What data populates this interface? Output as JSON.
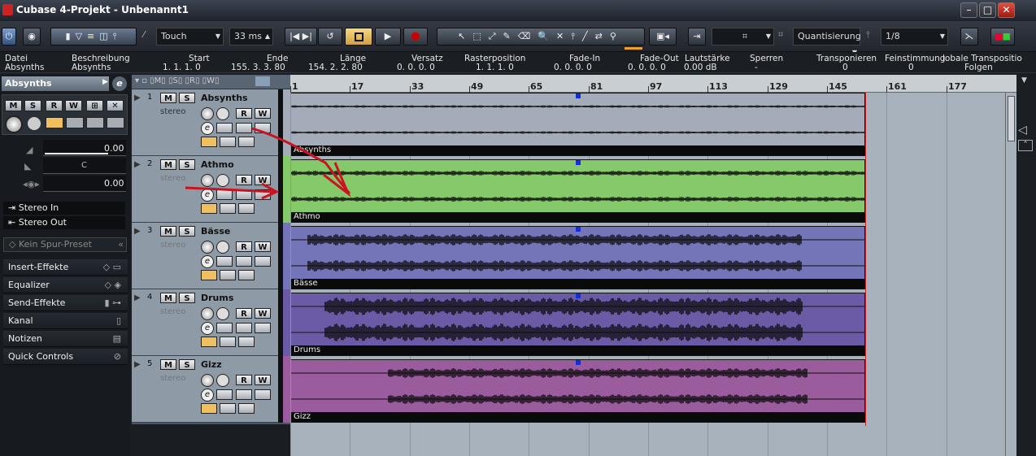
{
  "window": {
    "title": "Cubase 4-Projekt - Unbenannt1"
  },
  "toolbar": {
    "automation_mode": "Touch",
    "latency": "33 ms",
    "snap_type": "Quantisierung",
    "quantize": "1/8"
  },
  "infoline": {
    "headers": [
      "Datei",
      "Beschreibung",
      "Start",
      "Ende",
      "Länge",
      "Versatz",
      "Rasterposition",
      "Fade-In",
      "Fade-Out",
      "Lautstärke",
      "Sperren",
      "Transponieren",
      "Feinstimmung",
      "lobale Transpositio"
    ],
    "values": [
      "Absynths",
      "Absynths",
      "1. 1. 1.  0",
      "155. 3. 3. 80",
      "154. 2. 2. 80",
      "0. 0. 0.  0",
      "1. 1. 1.  0",
      "0. 0. 0.  0",
      "0. 0. 0.  0",
      "0.00 dB",
      "-",
      "0",
      "0",
      "Folgen"
    ]
  },
  "inspector": {
    "track_name": "Absynths",
    "volume": "0.00",
    "pan": "C",
    "send": "0.00",
    "input": "Stereo In",
    "output": "Stereo Out",
    "preset": "Kein Spur-Preset",
    "sections": [
      "Insert-Effekte",
      "Equalizer",
      "Send-Effekte",
      "Kanal",
      "Notizen",
      "Quick Controls"
    ]
  },
  "ruler": {
    "labels": [
      "1",
      "17",
      "33",
      "49",
      "65",
      "81",
      "97",
      "113",
      "129",
      "145",
      "161",
      "177"
    ]
  },
  "tracks": [
    {
      "num": "1",
      "name": "Absynths",
      "type": "stereo",
      "color": "#a3acb8",
      "event": "Absynths"
    },
    {
      "num": "2",
      "name": "Athmo",
      "type": "stereo",
      "color": "#86c96b",
      "event": "Athmo"
    },
    {
      "num": "3",
      "name": "Bässe",
      "type": "stereo",
      "color": "#7474b8",
      "event": "Bässe"
    },
    {
      "num": "4",
      "name": "Drums",
      "type": "stereo",
      "color": "#6b5aa6",
      "event": "Drums"
    },
    {
      "num": "5",
      "name": "Gizz",
      "type": "stereo",
      "color": "#9b5c9e",
      "event": "Gizz"
    }
  ]
}
